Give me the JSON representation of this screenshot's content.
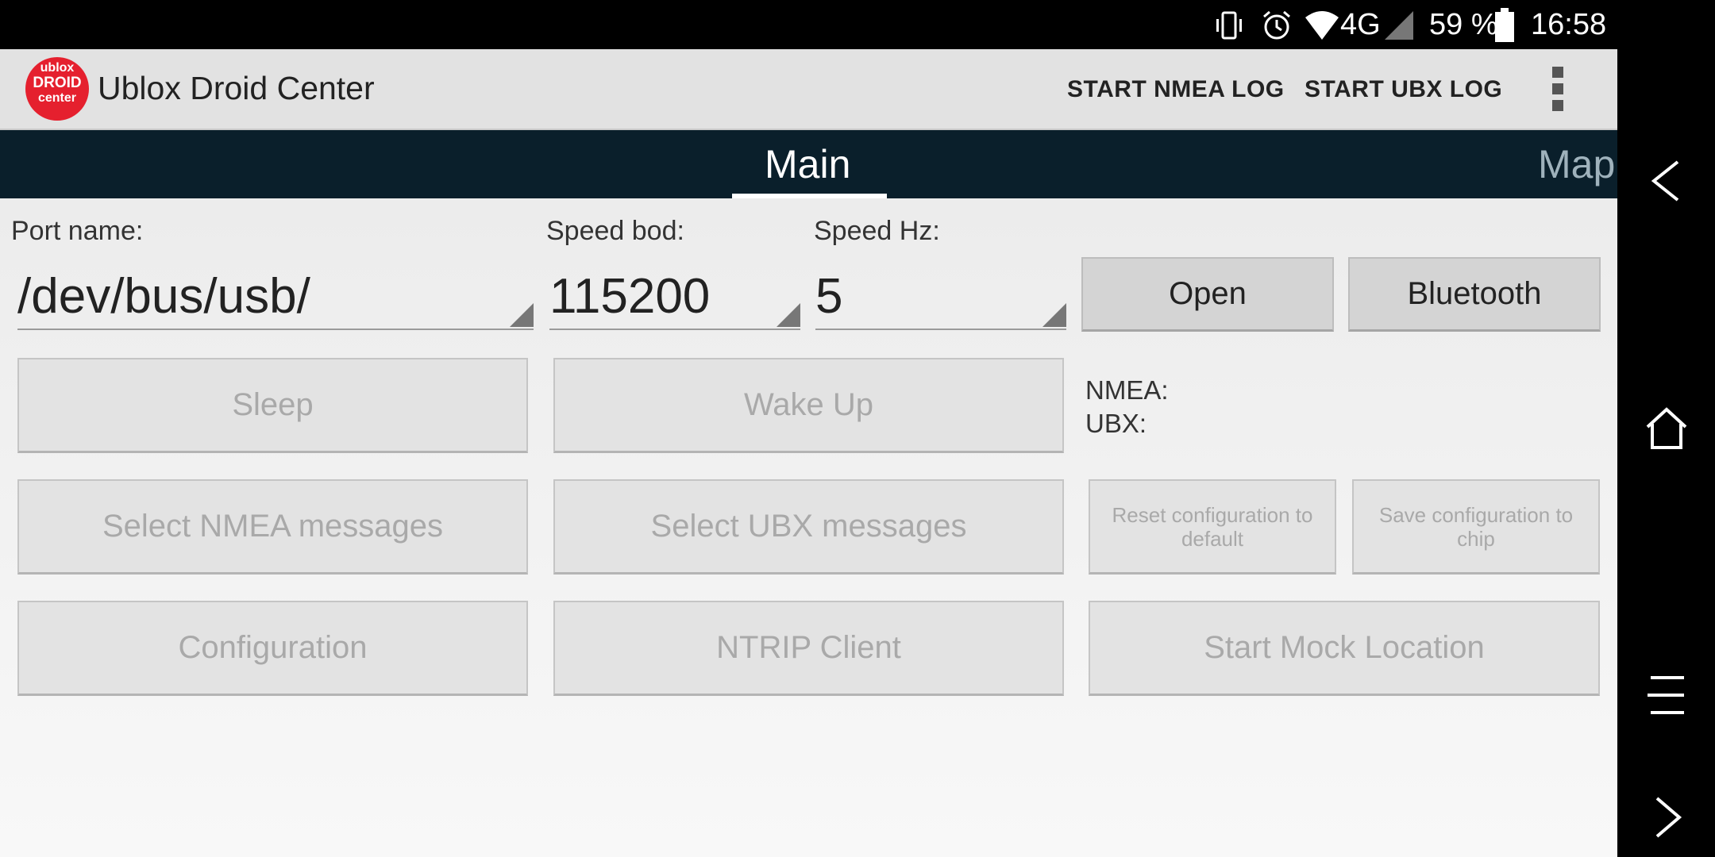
{
  "status_bar": {
    "network": "4G",
    "battery": "59 %",
    "time": "16:58",
    "icons": [
      "vibrate-icon",
      "alarm-icon",
      "wifi-icon",
      "cell-signal-icon",
      "battery-icon"
    ]
  },
  "app": {
    "logo_lines": [
      "ublox",
      "DROID",
      "center"
    ],
    "title": "Ublox Droid Center",
    "actions": [
      "START NMEA LOG",
      "START UBX LOG"
    ],
    "overflow_icon": "more-vert-icon"
  },
  "tabs": [
    {
      "label": "Main",
      "selected": true
    },
    {
      "label": "Map",
      "selected": false
    }
  ],
  "form": {
    "port_label": "Port name:",
    "port_value": "/dev/bus/usb/",
    "speed_bod_label": "Speed bod:",
    "speed_bod_value": "115200",
    "speed_hz_label": "Speed Hz:",
    "speed_hz_value": "5",
    "open_button": "Open",
    "bluetooth_button": "Bluetooth"
  },
  "buttons": {
    "sleep": "Sleep",
    "wake_up": "Wake Up",
    "select_nmea": "Select NMEA messages",
    "select_ubx": "Select UBX messages",
    "reset_config": "Reset configuration to default",
    "save_config": "Save configuration to chip",
    "configuration": "Configuration",
    "ntrip": "NTRIP Client",
    "mock_location": "Start Mock Location"
  },
  "info": {
    "nmea_label": "NMEA:",
    "ubx_label": "UBX:"
  },
  "colors": {
    "tab_bar": "#0a1f2b",
    "logo": "#e5202e",
    "action_bar": "#e2e2e2"
  }
}
